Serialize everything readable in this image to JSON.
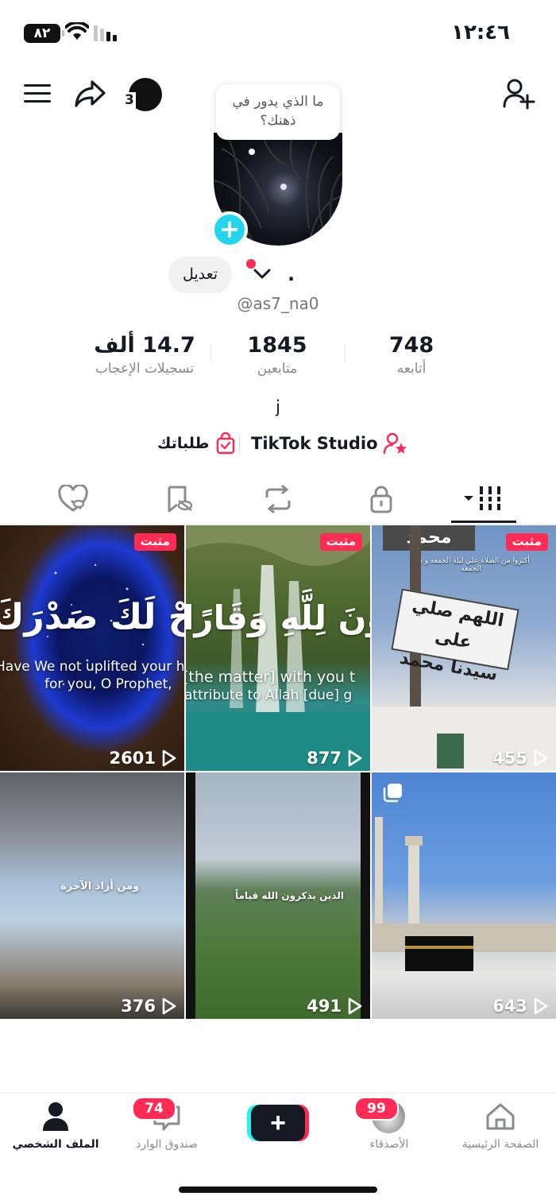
{
  "status_bar": {
    "time": "١٢:٤٦",
    "battery": "٨٢"
  },
  "header": {
    "story_count": "3"
  },
  "thought_bubble": {
    "text": "ما الذي يدور في ذهنك؟"
  },
  "profile": {
    "edit_label": "تعديل",
    "display_name": ".",
    "username": "@as7_na0",
    "bio": "j"
  },
  "stats": {
    "likes": {
      "value": "14.7 ألف",
      "label": "تسجيلات الإعجاب"
    },
    "followers": {
      "value": "1845",
      "label": "متابعين"
    },
    "following": {
      "value": "748",
      "label": "أتابعه"
    }
  },
  "links": {
    "studio": "TikTok Studio",
    "orders": "طلباتك"
  },
  "tabs": [
    "videos-grid",
    "private",
    "reposts",
    "favorites",
    "liked"
  ],
  "videos": [
    {
      "views": "2601",
      "pinned": "مثبت",
      "caption_main": "أَلَمْ نَشْرَحْ لَكَ صَدْرَكَ",
      "caption_en1": "Have We not uplifted your heart",
      "caption_en2": "for you, O Prophet,"
    },
    {
      "views": "877",
      "pinned": "مثبت",
      "caption_main": "لَا تَرْجُونَ لِلَّهِ وَقَارًا",
      "caption_en1": "[the matter] with you t",
      "caption_en2": "attribute to Allah [due] g"
    },
    {
      "views": "455",
      "pinned": "مثبت",
      "sign_top": "محمد",
      "sign_main1": "اللهم صلي على",
      "sign_main2": "سيدنا محمد",
      "note": "أكثروا من الصلاة علي ليلة الجمعة و يوم الجمعة"
    },
    {
      "views": "376",
      "caption": "ومن أراد الآخرة"
    },
    {
      "views": "491",
      "caption": "الذين يذكرون الله قياماً"
    },
    {
      "views": "643"
    }
  ],
  "bottom_nav": {
    "home": "الصفحة الرئيسية",
    "friends": "الأصدقاء",
    "friends_badge": "99",
    "inbox": "صندوق الوارد",
    "inbox_badge": "74",
    "profile": "الملف الشخصي"
  },
  "colors": {
    "accent": "#fe2c55",
    "cyan": "#20d5ec",
    "text": "#161823"
  }
}
